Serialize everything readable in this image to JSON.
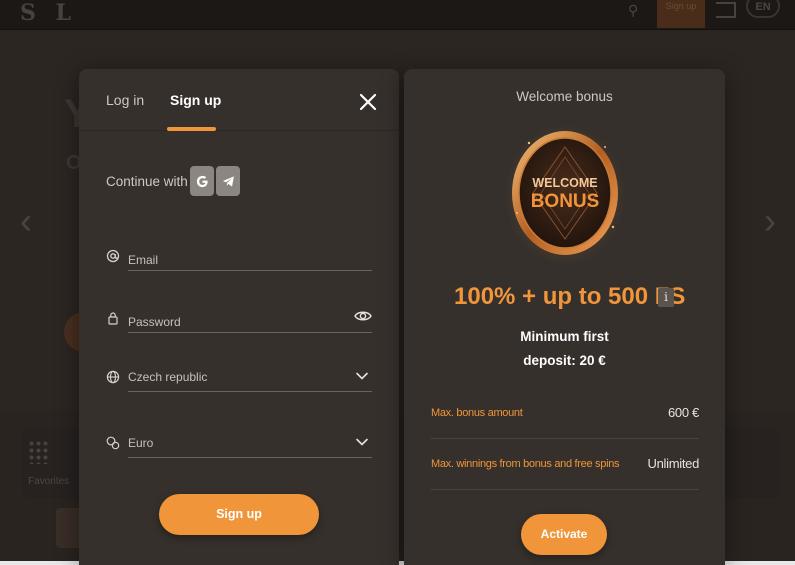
{
  "auth": {
    "tabs": [
      {
        "label": "Log in",
        "active": false
      },
      {
        "label": "Sign up",
        "active": true
      }
    ],
    "continue_label": "Continue with",
    "social": [
      "google-icon",
      "telegram-icon"
    ],
    "fields": {
      "email": {
        "placeholder": "Email",
        "value": ""
      },
      "password": {
        "placeholder": "Password",
        "value": ""
      },
      "country": {
        "value": "Czech republic"
      },
      "currency": {
        "value": "Euro"
      }
    },
    "submit_label": "Sign up"
  },
  "bonus": {
    "heading": "Welcome bonus",
    "coin_text": [
      "WELCOME",
      "BONUS"
    ],
    "offer": "100% + up to 500 FS",
    "info_badge": "i",
    "min_deposit_line1": "Minimum first",
    "min_deposit_line2": "deposit: 20 €",
    "rows": [
      {
        "label": "Max. bonus amount",
        "value": "600 €"
      },
      {
        "label": "Max. winnings from bonus and free spins",
        "value": "Unlimited"
      }
    ],
    "activate_label": "Activate"
  },
  "background": {
    "lang": "EN",
    "top_button": "Sign up",
    "category_label": "Favorites"
  },
  "colors": {
    "accent": "#f0953a",
    "panel": "#36302c",
    "backdrop": "#221d19"
  }
}
